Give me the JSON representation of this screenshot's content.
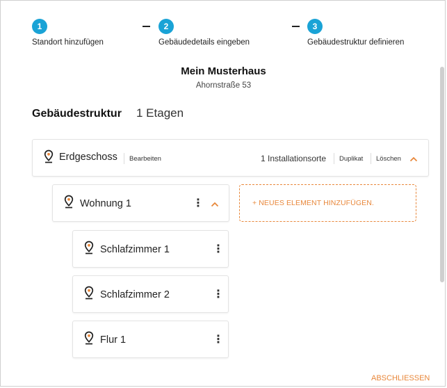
{
  "stepper": {
    "steps": [
      {
        "number": "1",
        "label": "Standort hinzufügen"
      },
      {
        "number": "2",
        "label": "Gebäudedetails eingeben"
      },
      {
        "number": "3",
        "label": "Gebäudestruktur definieren"
      }
    ]
  },
  "header": {
    "title": "Mein Musterhaus",
    "address": "Ahornstraße 53"
  },
  "structure": {
    "title": "Gebäudestruktur",
    "count": "1 Etagen"
  },
  "floor": {
    "name": "Erdgeschoss",
    "edit_label": "Bearbeiten",
    "installations": "1 Installationsorte",
    "duplicate_label": "Duplikat",
    "delete_label": "Löschen"
  },
  "unit": {
    "name": "Wohnung 1",
    "menu_glyph": "⋮"
  },
  "rooms": [
    {
      "name": "Schlafzimmer 1",
      "menu_glyph": "⋮"
    },
    {
      "name": "Schlafzimmer 2",
      "menu_glyph": "⋮"
    },
    {
      "name": "Flur 1",
      "menu_glyph": "⋮"
    }
  ],
  "add_element": {
    "label": "+ NEUES ELEMENT HINZUFÜGEN."
  },
  "footer": {
    "finish_label": "ABSCHLIESSEN"
  },
  "colors": {
    "step_blue": "#1aa3d6",
    "accent_orange": "#e8873a"
  },
  "icons": {
    "location": "location-pin-icon",
    "collapse": "chevron-up-icon",
    "menu": "kebab-menu-icon"
  }
}
